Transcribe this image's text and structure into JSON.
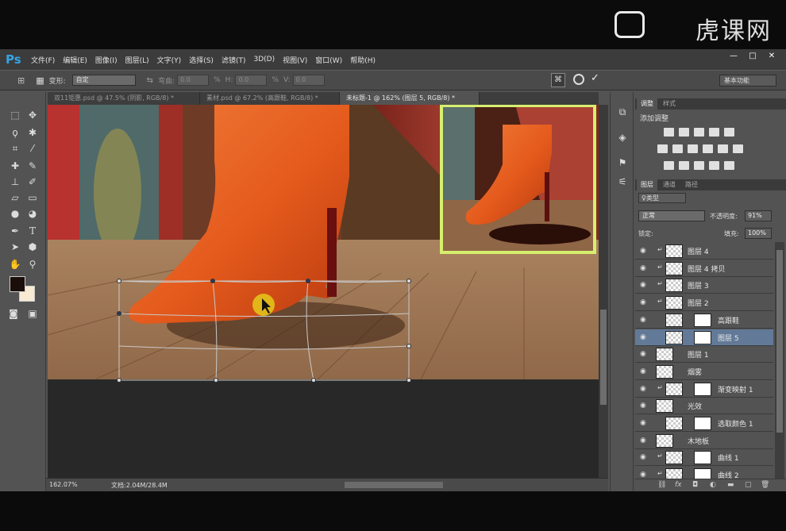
{
  "app": {
    "logo": "Ps",
    "watermark": "虎课网"
  },
  "menu": [
    "文件(F)",
    "编辑(E)",
    "图像(I)",
    "图层(L)",
    "文字(Y)",
    "选择(S)",
    "滤镜(T)",
    "3D(D)",
    "视图(V)",
    "窗口(W)",
    "帮助(H)"
  ],
  "window_controls": [
    "—",
    "□",
    "✕"
  ],
  "options": {
    "transform_label": "变形:",
    "transform_value": "自定",
    "bend_label": "弯曲:",
    "bend_value": "0.0",
    "bend_unit": "%",
    "h_label": "H:",
    "h_value": "0.0",
    "h_unit": "%",
    "v_label": "V:",
    "v_value": "0.0",
    "cancel_icon": "cancel-icon",
    "commit_icon": "check-icon",
    "workspace": "基本功能"
  },
  "tabs": [
    {
      "label": "双11钜惠.psd @ 47.5% (阴影, RGB/8) *",
      "active": false
    },
    {
      "label": "素材.psd @ 67.2% (高跟鞋, RGB/8) *",
      "active": false
    },
    {
      "label": "未标题-1 @ 162% (图层 5, RGB/8) *",
      "active": true
    }
  ],
  "status": {
    "zoom": "162.07%",
    "doc": "文档:2.04M/28.4M"
  },
  "adjustments": {
    "tabs": [
      "调整",
      "样式"
    ],
    "title": "添加调整"
  },
  "layers": {
    "tabs": [
      "图层",
      "通道",
      "路径"
    ],
    "filter_kind": "♀类型",
    "blend_mode": "正常",
    "opacity_label": "不透明度:",
    "opacity_value": "91%",
    "lock_label": "锁定:",
    "fill_label": "填充:",
    "fill_value": "100%",
    "rows": [
      {
        "name": "图层 4",
        "clip": true,
        "mask": false,
        "selected": false
      },
      {
        "name": "图层 4 拷贝",
        "clip": true,
        "mask": false,
        "selected": false
      },
      {
        "name": "图层 3",
        "clip": true,
        "mask": false,
        "selected": false
      },
      {
        "name": "图层 2",
        "clip": true,
        "mask": false,
        "selected": false
      },
      {
        "name": "高跟鞋",
        "clip": false,
        "mask": true,
        "selected": false
      },
      {
        "name": "图层 5",
        "clip": false,
        "mask": true,
        "selected": true
      },
      {
        "name": "图层 1",
        "clip": false,
        "mask": false,
        "selected": false
      },
      {
        "name": "烟雾",
        "clip": false,
        "mask": false,
        "selected": false
      },
      {
        "name": "渐变映射 1",
        "clip": true,
        "mask": true,
        "selected": false
      },
      {
        "name": "光效",
        "clip": false,
        "mask": false,
        "selected": false
      },
      {
        "name": "选取颜色 1",
        "clip": false,
        "mask": true,
        "selected": false
      },
      {
        "name": "木地板",
        "clip": false,
        "mask": false,
        "selected": false
      },
      {
        "name": "曲线 1",
        "clip": true,
        "mask": true,
        "selected": false
      },
      {
        "name": "曲线 2",
        "clip": true,
        "mask": true,
        "selected": false
      }
    ]
  },
  "colors": {
    "accent_frame": "#d7ef6f",
    "selected_row": "#627a98",
    "cursor": "#e3c21a"
  }
}
